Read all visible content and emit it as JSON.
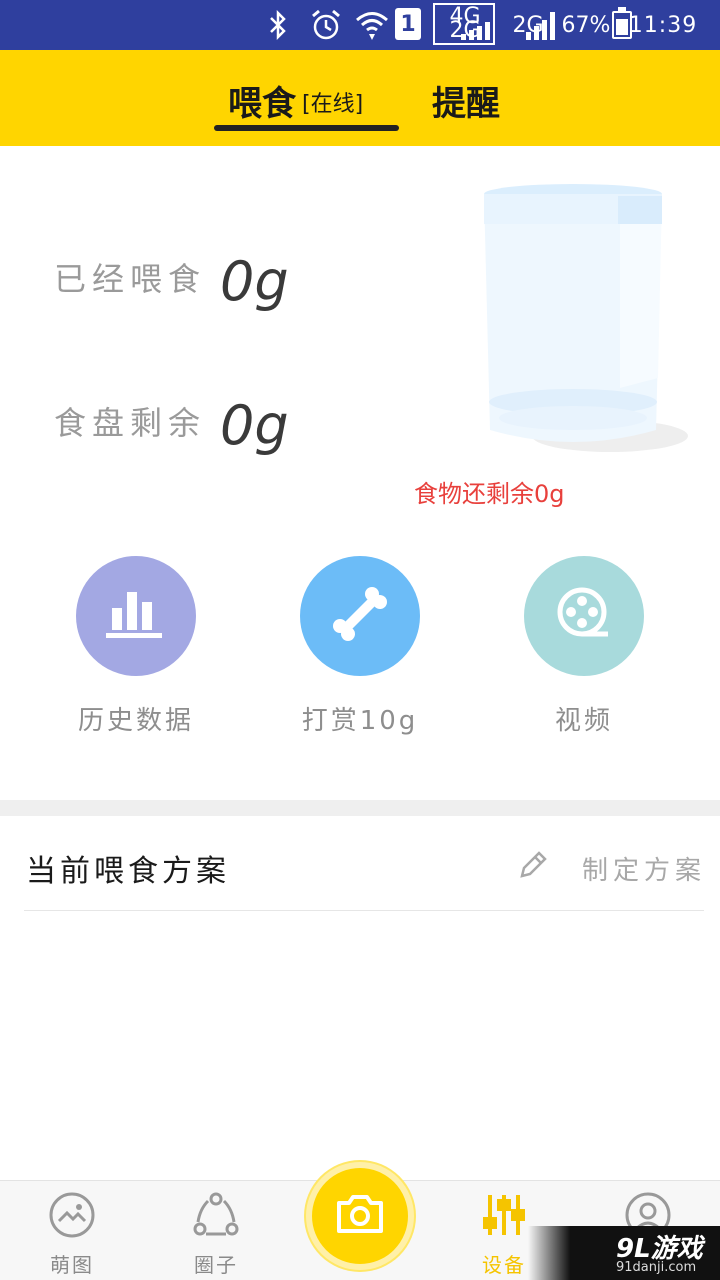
{
  "status_bar": {
    "network_1_top": "4G",
    "network_1_bottom": "2G",
    "network_2": "2G",
    "sim_slot": "1",
    "battery": "67%",
    "time": "11:39"
  },
  "header": {
    "tabs": [
      {
        "label": "喂食",
        "status": "[在线]",
        "active": true
      },
      {
        "label": "提醒",
        "active": false
      }
    ],
    "background": "#ffd500"
  },
  "stats": {
    "fed_label": "已经喂食",
    "fed_value": "0g",
    "bowl_label": "食盘剩余",
    "bowl_value": "0g",
    "food_remaining": "食物还剩余0g"
  },
  "actions": [
    {
      "label": "历史数据",
      "icon": "bar-chart-icon",
      "color": "#a3a8e3"
    },
    {
      "label": "打赏10g",
      "icon": "bone-icon",
      "color": "#6cbcf7"
    },
    {
      "label": "视频",
      "icon": "film-reel-icon",
      "color": "#a8dadc"
    }
  ],
  "plan": {
    "title": "当前喂食方案",
    "make_label": "制定方案"
  },
  "bottom_nav": {
    "items": [
      {
        "label": "萌图",
        "icon": "smile-picture-icon"
      },
      {
        "label": "圈子",
        "icon": "share-circle-icon"
      },
      {
        "label": "设备",
        "icon": "sliders-icon",
        "active": true
      },
      {
        "label": "",
        "icon": "profile-icon"
      }
    ],
    "center_icon": "camera-icon",
    "active_color": "#f5c400"
  },
  "watermark": {
    "logo": "9L游戏",
    "url": "91danji.com"
  }
}
